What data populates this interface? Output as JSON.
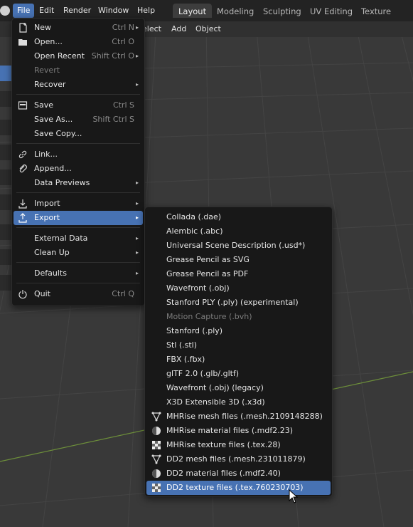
{
  "topbar": {
    "menus": [
      "File",
      "Edit",
      "Render",
      "Window",
      "Help"
    ],
    "workspaces": [
      "Layout",
      "Modeling",
      "Sculpting",
      "UV Editing",
      "Texture Paint"
    ]
  },
  "header2": {
    "items": [
      "elect",
      "Add",
      "Object"
    ]
  },
  "file_menu": {
    "items": [
      {
        "label": "New",
        "shortcut": "Ctrl N",
        "icon": "new-file-icon"
      },
      {
        "label": "Open...",
        "shortcut": "Ctrl O",
        "icon": "folder-icon"
      },
      {
        "label": "Open Recent",
        "shortcut": "Shift Ctrl O"
      },
      {
        "label": "Revert",
        "shortcut": ""
      },
      {
        "label": "Recover",
        "shortcut": ""
      },
      {
        "label": "Save",
        "shortcut": "Ctrl S",
        "icon": "save-icon"
      },
      {
        "label": "Save As...",
        "shortcut": "Shift Ctrl S"
      },
      {
        "label": "Save Copy...",
        "shortcut": ""
      },
      {
        "label": "Link...",
        "shortcut": "",
        "icon": "link-icon"
      },
      {
        "label": "Append...",
        "shortcut": "",
        "icon": "append-icon"
      },
      {
        "label": "Data Previews",
        "shortcut": ""
      },
      {
        "label": "Import",
        "shortcut": "",
        "icon": "import-icon"
      },
      {
        "label": "Export",
        "shortcut": "",
        "icon": "export-icon"
      },
      {
        "label": "External Data",
        "shortcut": ""
      },
      {
        "label": "Clean Up",
        "shortcut": ""
      },
      {
        "label": "Defaults",
        "shortcut": ""
      },
      {
        "label": "Quit",
        "shortcut": "Ctrl Q",
        "icon": "quit-icon"
      }
    ]
  },
  "export_menu": {
    "items": [
      {
        "label": "Collada (.dae)"
      },
      {
        "label": "Alembic (.abc)"
      },
      {
        "label": "Universal Scene Description (.usd*)"
      },
      {
        "label": "Grease Pencil as SVG"
      },
      {
        "label": "Grease Pencil as PDF"
      },
      {
        "label": "Wavefront (.obj)"
      },
      {
        "label": "Stanford PLY (.ply) (experimental)"
      },
      {
        "label": "Motion Capture (.bvh)"
      },
      {
        "label": "Stanford (.ply)"
      },
      {
        "label": "Stl (.stl)"
      },
      {
        "label": "FBX (.fbx)"
      },
      {
        "label": "glTF 2.0 (.glb/.gltf)"
      },
      {
        "label": "Wavefront (.obj) (legacy)"
      },
      {
        "label": "X3D Extensible 3D (.x3d)"
      },
      {
        "label": "MHRise mesh files (.mesh.2109148288)",
        "icon": "mesh-icon"
      },
      {
        "label": "MHRise material files (.mdf2.23)",
        "icon": "material-icon"
      },
      {
        "label": "MHRise texture files (.tex.28)",
        "icon": "texture-icon"
      },
      {
        "label": "DD2 mesh files (.mesh.231011879)",
        "icon": "mesh-icon"
      },
      {
        "label": "DD2 material files (.mdf2.40)",
        "icon": "material-icon"
      },
      {
        "label": "DD2 texture files (.tex.760230703)",
        "icon": "texture-icon"
      }
    ]
  },
  "colors": {
    "highlight": "#4772b3",
    "menu_bg": "#181818",
    "topbar_bg": "#232323"
  }
}
